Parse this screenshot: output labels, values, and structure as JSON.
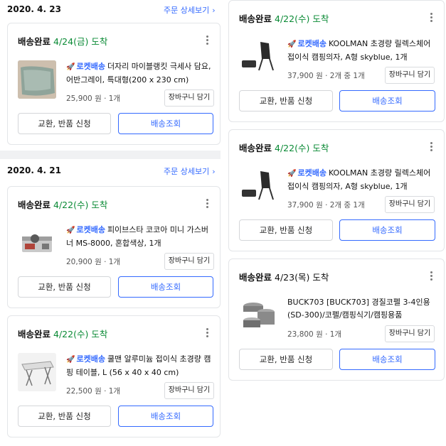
{
  "groups": [
    {
      "date": "2020. 4. 23",
      "detail_link": "주문 상세보기"
    },
    {
      "date": "2020. 4. 21",
      "detail_link": "주문 상세보기"
    }
  ],
  "cart_label": "장바구니 담기",
  "return_label": "교환, 반품 신청",
  "track_label": "배송조회",
  "rocket_label": "로켓배송",
  "chevron_glyph": "›",
  "orders": [
    {
      "status": "배송완료",
      "arrival": "4/24(금) 도착",
      "rocket": true,
      "name": "더자리 마이블랭킷 극세사 담요, 어반그레이, 특대형(200 x 230 cm)",
      "price": "25,900 원 · 1개",
      "icon": "blanket-icon"
    },
    {
      "status": "배송완료",
      "arrival": "4/22(수) 도착",
      "rocket": true,
      "name": "피이브스타 코코아 미니 가스버너 MS-8000, 혼합색상, 1개",
      "price": "20,900 원 · 1개",
      "icon": "gas-burner-icon"
    },
    {
      "status": "배송완료",
      "arrival": "4/22(수) 도착",
      "rocket": true,
      "name": "쿨맨 알루미늄 접이식 초경량 캠핑 테이블, L (56 x 40 x 40 cm)",
      "price": "22,500 원 · 1개",
      "icon": "camping-table-icon"
    },
    {
      "status": "배송완료",
      "arrival": "4/22(수) 도착",
      "rocket": true,
      "name": "KOOLMAN 초경량 릴렉스체어 접이식 캠핑의자, A형 skyblue, 1개",
      "price": "37,900 원 · 2개 중 1개",
      "icon": "camping-chair-icon"
    },
    {
      "status": "배송완료",
      "arrival": "4/22(수) 도착",
      "rocket": true,
      "name": "KOOLMAN 초경량 릴렉스체어 접이식 캠핑의자, A형 skyblue, 1개",
      "price": "37,900 원 · 2개 중 1개",
      "icon": "camping-chair-icon"
    },
    {
      "status": "배송완료",
      "arrival": "4/23(목) 도착",
      "rocket": false,
      "name": "BUCK703 [BUCK703] 경질코펠 3-4인용(SD-300)/코펠/캠핑식기/캠핑용품",
      "price": "23,800 원 · 1개",
      "icon": "cookware-set-icon"
    }
  ],
  "colors": {
    "accent": "#346aff",
    "arrival_green": "#0a8a35",
    "separator": "#f0f1f3"
  }
}
